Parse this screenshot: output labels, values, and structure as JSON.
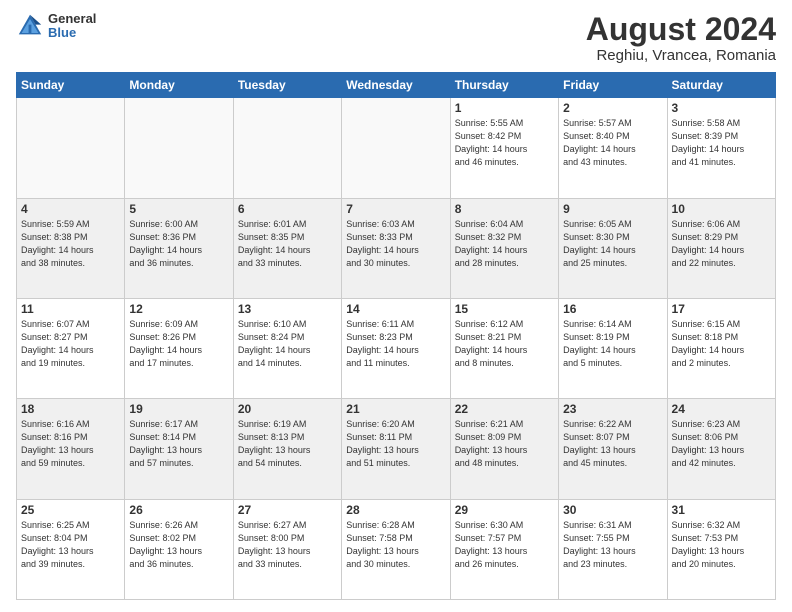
{
  "header": {
    "logo_general": "General",
    "logo_blue": "Blue",
    "title": "August 2024",
    "subtitle": "Reghiu, Vrancea, Romania"
  },
  "weekdays": [
    "Sunday",
    "Monday",
    "Tuesday",
    "Wednesday",
    "Thursday",
    "Friday",
    "Saturday"
  ],
  "weeks": [
    [
      {
        "day": "",
        "info": "",
        "empty": true
      },
      {
        "day": "",
        "info": "",
        "empty": true
      },
      {
        "day": "",
        "info": "",
        "empty": true
      },
      {
        "day": "",
        "info": "",
        "empty": true
      },
      {
        "day": "1",
        "info": "Sunrise: 5:55 AM\nSunset: 8:42 PM\nDaylight: 14 hours\nand 46 minutes."
      },
      {
        "day": "2",
        "info": "Sunrise: 5:57 AM\nSunset: 8:40 PM\nDaylight: 14 hours\nand 43 minutes."
      },
      {
        "day": "3",
        "info": "Sunrise: 5:58 AM\nSunset: 8:39 PM\nDaylight: 14 hours\nand 41 minutes."
      }
    ],
    [
      {
        "day": "4",
        "info": "Sunrise: 5:59 AM\nSunset: 8:38 PM\nDaylight: 14 hours\nand 38 minutes."
      },
      {
        "day": "5",
        "info": "Sunrise: 6:00 AM\nSunset: 8:36 PM\nDaylight: 14 hours\nand 36 minutes."
      },
      {
        "day": "6",
        "info": "Sunrise: 6:01 AM\nSunset: 8:35 PM\nDaylight: 14 hours\nand 33 minutes."
      },
      {
        "day": "7",
        "info": "Sunrise: 6:03 AM\nSunset: 8:33 PM\nDaylight: 14 hours\nand 30 minutes."
      },
      {
        "day": "8",
        "info": "Sunrise: 6:04 AM\nSunset: 8:32 PM\nDaylight: 14 hours\nand 28 minutes."
      },
      {
        "day": "9",
        "info": "Sunrise: 6:05 AM\nSunset: 8:30 PM\nDaylight: 14 hours\nand 25 minutes."
      },
      {
        "day": "10",
        "info": "Sunrise: 6:06 AM\nSunset: 8:29 PM\nDaylight: 14 hours\nand 22 minutes."
      }
    ],
    [
      {
        "day": "11",
        "info": "Sunrise: 6:07 AM\nSunset: 8:27 PM\nDaylight: 14 hours\nand 19 minutes."
      },
      {
        "day": "12",
        "info": "Sunrise: 6:09 AM\nSunset: 8:26 PM\nDaylight: 14 hours\nand 17 minutes."
      },
      {
        "day": "13",
        "info": "Sunrise: 6:10 AM\nSunset: 8:24 PM\nDaylight: 14 hours\nand 14 minutes."
      },
      {
        "day": "14",
        "info": "Sunrise: 6:11 AM\nSunset: 8:23 PM\nDaylight: 14 hours\nand 11 minutes."
      },
      {
        "day": "15",
        "info": "Sunrise: 6:12 AM\nSunset: 8:21 PM\nDaylight: 14 hours\nand 8 minutes."
      },
      {
        "day": "16",
        "info": "Sunrise: 6:14 AM\nSunset: 8:19 PM\nDaylight: 14 hours\nand 5 minutes."
      },
      {
        "day": "17",
        "info": "Sunrise: 6:15 AM\nSunset: 8:18 PM\nDaylight: 14 hours\nand 2 minutes."
      }
    ],
    [
      {
        "day": "18",
        "info": "Sunrise: 6:16 AM\nSunset: 8:16 PM\nDaylight: 13 hours\nand 59 minutes."
      },
      {
        "day": "19",
        "info": "Sunrise: 6:17 AM\nSunset: 8:14 PM\nDaylight: 13 hours\nand 57 minutes."
      },
      {
        "day": "20",
        "info": "Sunrise: 6:19 AM\nSunset: 8:13 PM\nDaylight: 13 hours\nand 54 minutes."
      },
      {
        "day": "21",
        "info": "Sunrise: 6:20 AM\nSunset: 8:11 PM\nDaylight: 13 hours\nand 51 minutes."
      },
      {
        "day": "22",
        "info": "Sunrise: 6:21 AM\nSunset: 8:09 PM\nDaylight: 13 hours\nand 48 minutes."
      },
      {
        "day": "23",
        "info": "Sunrise: 6:22 AM\nSunset: 8:07 PM\nDaylight: 13 hours\nand 45 minutes."
      },
      {
        "day": "24",
        "info": "Sunrise: 6:23 AM\nSunset: 8:06 PM\nDaylight: 13 hours\nand 42 minutes."
      }
    ],
    [
      {
        "day": "25",
        "info": "Sunrise: 6:25 AM\nSunset: 8:04 PM\nDaylight: 13 hours\nand 39 minutes."
      },
      {
        "day": "26",
        "info": "Sunrise: 6:26 AM\nSunset: 8:02 PM\nDaylight: 13 hours\nand 36 minutes."
      },
      {
        "day": "27",
        "info": "Sunrise: 6:27 AM\nSunset: 8:00 PM\nDaylight: 13 hours\nand 33 minutes."
      },
      {
        "day": "28",
        "info": "Sunrise: 6:28 AM\nSunset: 7:58 PM\nDaylight: 13 hours\nand 30 minutes."
      },
      {
        "day": "29",
        "info": "Sunrise: 6:30 AM\nSunset: 7:57 PM\nDaylight: 13 hours\nand 26 minutes."
      },
      {
        "day": "30",
        "info": "Sunrise: 6:31 AM\nSunset: 7:55 PM\nDaylight: 13 hours\nand 23 minutes."
      },
      {
        "day": "31",
        "info": "Sunrise: 6:32 AM\nSunset: 7:53 PM\nDaylight: 13 hours\nand 20 minutes."
      }
    ]
  ]
}
